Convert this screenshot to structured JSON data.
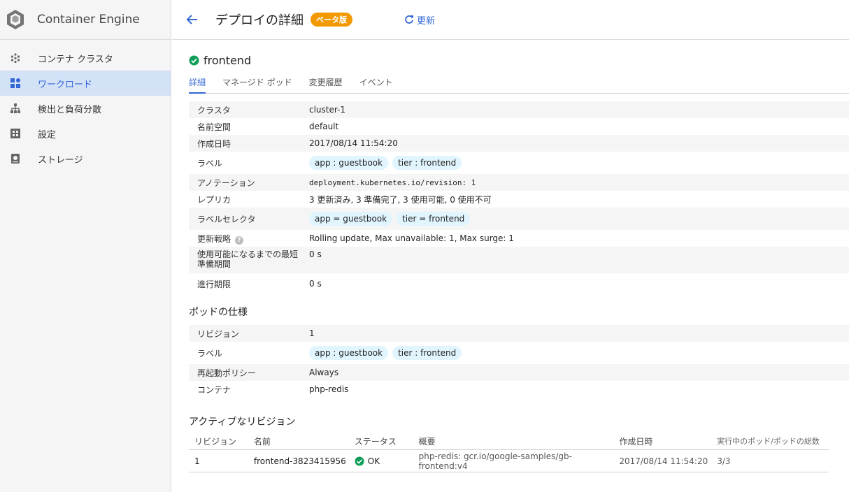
{
  "app": {
    "title": "Container Engine"
  },
  "sidebar": {
    "items": [
      {
        "label": "コンテナ クラスタ",
        "icon": "cluster-icon"
      },
      {
        "label": "ワークロード",
        "icon": "workloads-icon"
      },
      {
        "label": "検出と負荷分散",
        "icon": "network-icon"
      },
      {
        "label": "設定",
        "icon": "config-icon"
      },
      {
        "label": "ストレージ",
        "icon": "storage-icon"
      }
    ]
  },
  "header": {
    "title": "デプロイの詳細",
    "beta": "ベータ版",
    "refresh": "更新"
  },
  "deployment": {
    "name": "frontend",
    "status_icon": "check-circle-icon"
  },
  "tabs": [
    "詳細",
    "マネージド ポッド",
    "変更履歴",
    "イベント"
  ],
  "details": {
    "cluster_label": "クラスタ",
    "cluster_value": "cluster-1",
    "namespace_label": "名前空間",
    "namespace_value": "default",
    "created_label": "作成日時",
    "created_value": "2017/08/14 11:54:20",
    "labels_label": "ラベル",
    "labels": [
      "app : guestbook",
      "tier : frontend"
    ],
    "annotation_label": "アノテーション",
    "annotation_value": "deployment.kubernetes.io/revision: 1",
    "replicas_label": "レプリカ",
    "replicas_value": "3 更新済み, 3 準備完了, 3 使用可能, 0 使用不可",
    "selector_label": "ラベルセレクタ",
    "selectors": [
      "app = guestbook",
      "tier = frontend"
    ],
    "strategy_label": "更新戦略",
    "strategy_value": "Rolling update, Max unavailable: 1, Max surge: 1",
    "minready_label_1": "使用可能になるまでの最短",
    "minready_label_2": "準備期間",
    "minready_value": "0 s",
    "deadline_label": "進行期限",
    "deadline_value": "0 s"
  },
  "pod_spec": {
    "title": "ポッドの仕様",
    "revision_label": "リビジョン",
    "revision_value": "1",
    "labels_label": "ラベル",
    "labels": [
      "app : guestbook",
      "tier : frontend"
    ],
    "restart_label": "再起動ポリシー",
    "restart_value": "Always",
    "container_label": "コンテナ",
    "container_value": "php-redis"
  },
  "active_revisions": {
    "title": "アクティブなリビジョン",
    "columns": [
      "リビジョン",
      "名前",
      "ステータス",
      "概要",
      "作成日時",
      "実行中のポッド/ポッドの総数"
    ],
    "rows": [
      {
        "revision": "1",
        "name": "frontend-3823415956",
        "status": "OK",
        "summary": "php-redis: gcr.io/google-samples/gb-frontend:v4",
        "created": "2017/08/14 11:54:20",
        "pods": "3/3"
      }
    ]
  }
}
